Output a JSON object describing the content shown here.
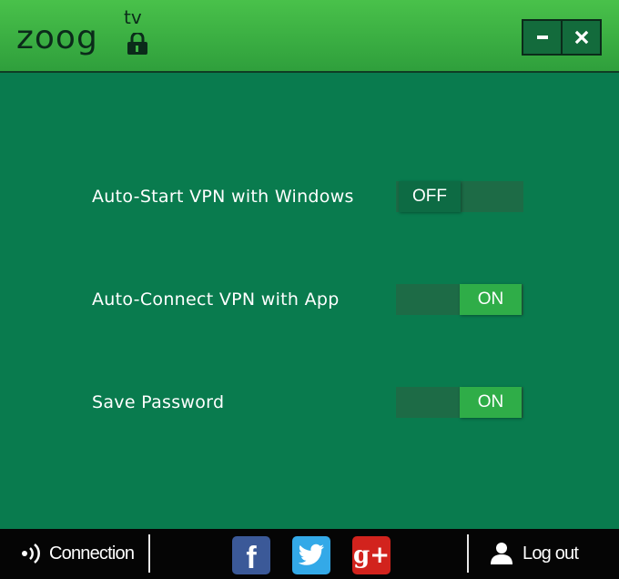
{
  "app": {
    "logo_text": "zoog",
    "logo_superscript": "tv"
  },
  "window_controls": {
    "minimize_icon": "minimize-icon",
    "close_icon": "close-icon"
  },
  "settings": [
    {
      "label": "Auto-Start VPN with Windows",
      "state": "OFF",
      "on": false
    },
    {
      "label": "Auto-Connect VPN with App",
      "state": "ON",
      "on": true
    },
    {
      "label": "Save Password",
      "state": "ON",
      "on": true
    }
  ],
  "footer": {
    "connection_label": "Connection",
    "connection_icon": "signal-icon",
    "facebook_glyph": "f",
    "googleplus_glyph": "g+",
    "logout_label": "Log out",
    "logout_icon": "user-icon"
  },
  "colors": {
    "background": "#097b4e",
    "titlebar": "#3fb344",
    "toggle_on": "#2fad48",
    "toggle_off": "#0d6b44",
    "facebook": "#3b5998",
    "twitter": "#33a9e8",
    "googleplus": "#d2231d"
  }
}
